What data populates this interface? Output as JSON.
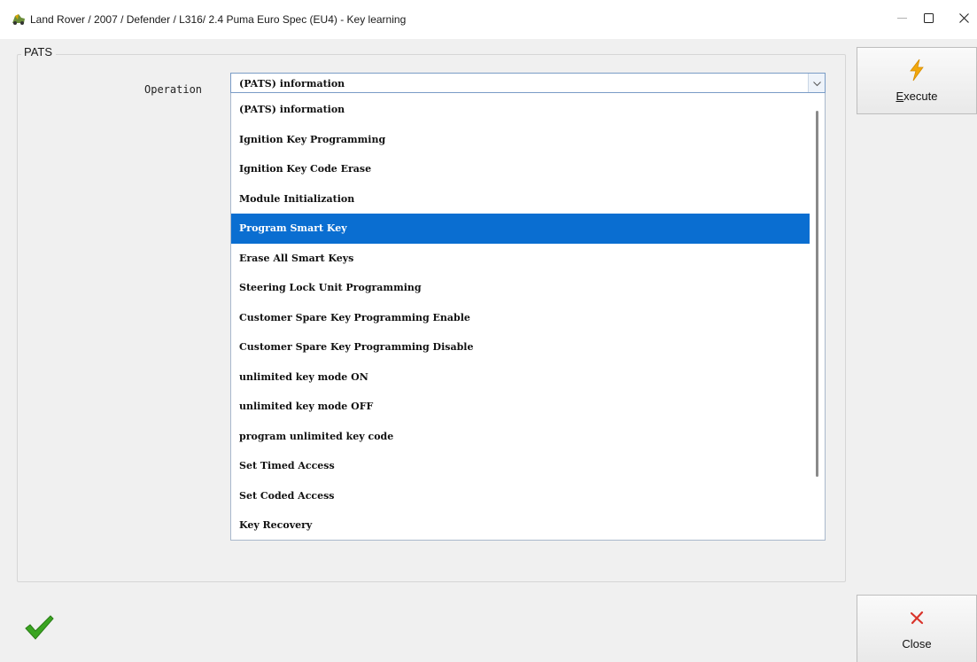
{
  "window": {
    "title": "Land Rover / 2007 / Defender / L316/ 2.4 Puma Euro Spec (EU4) - Key learning",
    "icon": "app-car-icon",
    "controls": {
      "minimize_icon": "minimize-icon",
      "maximize_icon": "maximize-icon",
      "close_icon": "close-icon"
    }
  },
  "group": {
    "title": "PATS"
  },
  "operation": {
    "label": "Operation",
    "selected_value": "(PATS) information",
    "options": [
      "(PATS) information",
      "Ignition Key Programming",
      "Ignition Key Code Erase",
      "Module Initialization",
      "Program Smart Key",
      "Erase All Smart Keys",
      "Steering Lock Unit Programming",
      "Customer Spare Key Programming Enable",
      "Customer Spare Key Programming Disable",
      "unlimited key mode ON",
      "unlimited key mode OFF",
      "program unlimited key code",
      "Set Timed Access",
      "Set Coded Access",
      "Key Recovery"
    ],
    "highlighted_index": 4
  },
  "buttons": {
    "execute": {
      "label_first": "E",
      "label_rest": "xecute",
      "icon": "lightning-icon"
    },
    "close": {
      "label": "Close",
      "icon": "x-mark-icon"
    }
  },
  "status": {
    "icon": "green-check-icon"
  },
  "colors": {
    "selection": "#0a6ed1",
    "execute_icon": "#f2a80c",
    "close_icon": "#d9342b",
    "check_icon": "#3aa521"
  }
}
